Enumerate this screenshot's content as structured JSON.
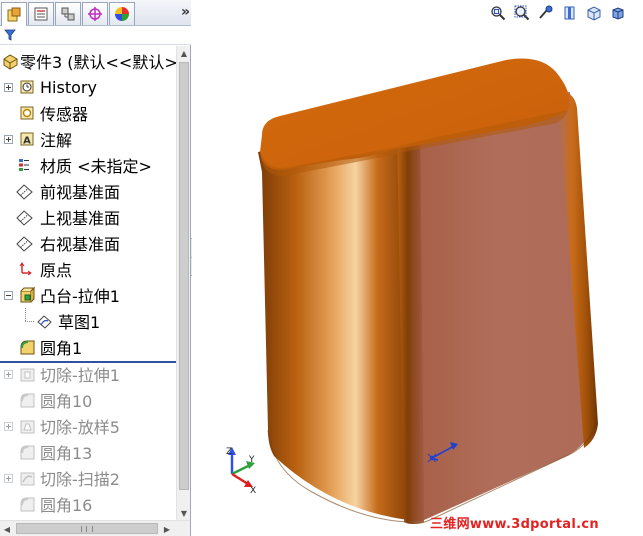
{
  "panel": {
    "more_label": "»",
    "tabs": [
      "feature-manager",
      "property-manager",
      "configuration-manager",
      "dim-xpert-manager",
      "display-manager"
    ]
  },
  "tree": {
    "root_label": "零件3 (默认<<默认>",
    "items": [
      {
        "label": "History",
        "dim": false
      },
      {
        "label": "传感器",
        "dim": false
      },
      {
        "label": "注解",
        "dim": false
      },
      {
        "label": "材质 <未指定>",
        "dim": false
      },
      {
        "label": "前视基准面",
        "dim": false
      },
      {
        "label": "上视基准面",
        "dim": false
      },
      {
        "label": "右视基准面",
        "dim": false
      },
      {
        "label": "原点",
        "dim": false
      },
      {
        "label": "凸台-拉伸1",
        "dim": false
      },
      {
        "label": "草图1",
        "dim": false
      },
      {
        "label": "圆角1",
        "dim": false
      },
      {
        "label": "切除-拉伸1",
        "dim": true
      },
      {
        "label": "圆角10",
        "dim": true
      },
      {
        "label": "切除-放样5",
        "dim": true
      },
      {
        "label": "圆角13",
        "dim": true
      },
      {
        "label": "切除-扫描2",
        "dim": true
      },
      {
        "label": "圆角16",
        "dim": true
      }
    ]
  },
  "triad": {
    "z_label": "Z",
    "y_label": "Y",
    "x_label": "X"
  },
  "watermark": "三维网www.3dportal.cn",
  "colors": {
    "body_front": "#b06e5a",
    "body_top": "#cf650c",
    "body_side": "#c0640e",
    "watermark": "#e32222"
  }
}
